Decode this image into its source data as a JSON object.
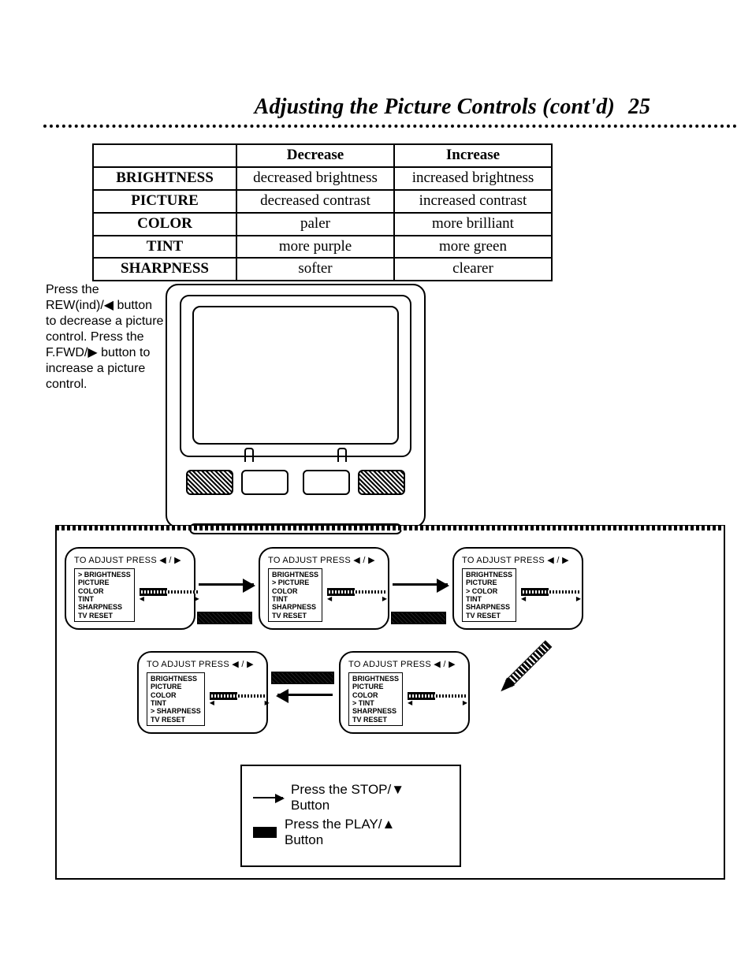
{
  "heading": {
    "title": "Adjusting the Picture Controls (cont'd)",
    "page_number": "25"
  },
  "table": {
    "headers": [
      "",
      "Decrease",
      "Increase"
    ],
    "rows": [
      {
        "name": "BRIGHTNESS",
        "decrease": "decreased brightness",
        "increase": "increased brightness"
      },
      {
        "name": "PICTURE",
        "decrease": "decreased contrast",
        "increase": "increased contrast"
      },
      {
        "name": "COLOR",
        "decrease": "paler",
        "increase": "more brilliant"
      },
      {
        "name": "TINT",
        "decrease": "more purple",
        "increase": "more green"
      },
      {
        "name": "SHARPNESS",
        "decrease": "softer",
        "increase": "clearer"
      }
    ]
  },
  "instruction": {
    "line1": "Press the",
    "line2_pre": "REW(ind)/",
    "line2_icon": "◀",
    "line2_post": " button",
    "line3": "to decrease a picture",
    "line4": "control. Press the",
    "line5_pre": "F.FWD/",
    "line5_icon": "▶",
    "line5_post": " button to",
    "line6": "increase a picture",
    "line7": "control."
  },
  "osd_common": {
    "header_text": "TO ADJUST PRESS ◀ / ▶",
    "menu_items": [
      "BRIGHTNESS",
      "PICTURE",
      "COLOR",
      "TINT",
      "SHARPNESS",
      "TV RESET"
    ]
  },
  "osd_panels": [
    {
      "id": "osd-brightness",
      "selected": "BRIGHTNESS"
    },
    {
      "id": "osd-picture",
      "selected": "PICTURE"
    },
    {
      "id": "osd-color",
      "selected": "COLOR"
    },
    {
      "id": "osd-tint",
      "selected": "TINT"
    },
    {
      "id": "osd-sharpness",
      "selected": "SHARPNESS"
    }
  ],
  "legend": {
    "stop_pre": "Press the STOP/",
    "stop_icon": "▼",
    "stop_post": "Button",
    "play_pre": "Press the PLAY/",
    "play_icon": "▲",
    "play_post": "Button"
  }
}
